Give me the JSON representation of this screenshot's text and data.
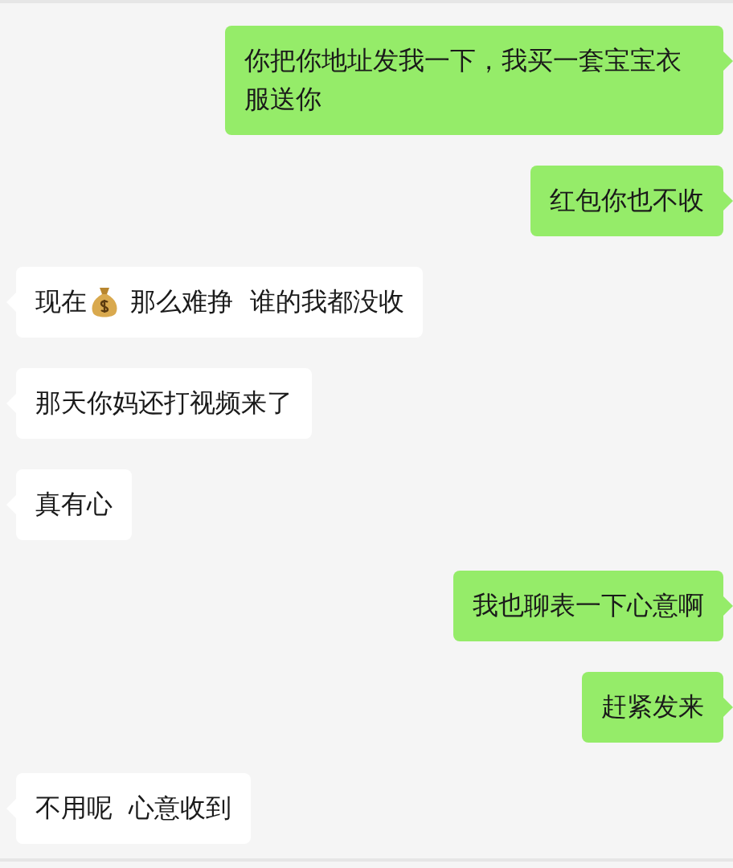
{
  "messages": [
    {
      "kind": "sent",
      "segments": [
        {
          "kind": "text",
          "text": "你把你地址发我一下，我买一套宝宝衣服送你"
        }
      ]
    },
    {
      "kind": "sent",
      "segments": [
        {
          "kind": "text",
          "text": "红包你也不收"
        }
      ]
    },
    {
      "kind": "received",
      "segments": [
        {
          "kind": "text",
          "text": "现在"
        },
        {
          "kind": "icon"
        },
        {
          "kind": "text",
          "text": " 那么难挣  谁的我都没收"
        }
      ]
    },
    {
      "kind": "received",
      "segments": [
        {
          "kind": "text",
          "text": "那天你妈还打视频来了"
        }
      ]
    },
    {
      "kind": "received",
      "segments": [
        {
          "kind": "text",
          "text": "真有心"
        }
      ]
    },
    {
      "kind": "sent",
      "segments": [
        {
          "kind": "text",
          "text": "我也聊表一下心意啊"
        }
      ]
    },
    {
      "kind": "sent",
      "segments": [
        {
          "kind": "text",
          "text": "赶紧发来"
        }
      ]
    },
    {
      "kind": "received",
      "segments": [
        {
          "kind": "text",
          "text": "不用呢  心意收到"
        }
      ]
    }
  ]
}
